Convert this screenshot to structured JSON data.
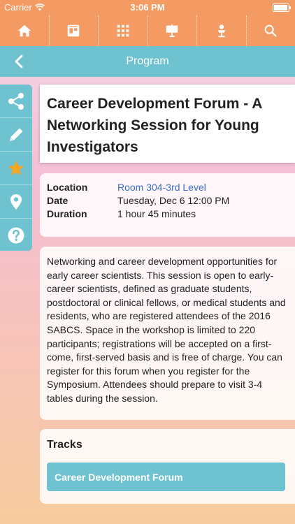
{
  "status_bar": {
    "carrier": "Carrier",
    "time": "3:06 PM"
  },
  "nav": {
    "icons": [
      "home-icon",
      "exhibitor-booth-icon",
      "floor-grid-icon",
      "presentation-board-icon",
      "speaker-podium-icon",
      "search-icon"
    ]
  },
  "header": {
    "title": "Program"
  },
  "side_toolbar": {
    "icons": [
      "share-icon",
      "pencil-icon",
      "star-icon",
      "map-pin-icon",
      "help-icon"
    ],
    "star_color": "#f5a623"
  },
  "session": {
    "title": "Career Development Forum - A Networking Session for Young Investigators",
    "location_label": "Location",
    "location_value": "Room 304-3rd Level",
    "date_label": "Date",
    "date_value": "Tuesday, Dec 6 12:00 PM",
    "duration_label": "Duration",
    "duration_value": "1 hour 45 minutes",
    "description": "Networking and career development opportunities for early career scientists. This session is open to early-career scientists, defined as graduate students, postdoctoral or clinical fellows, or medical students and residents, who are registered attendees of the 2016 SABCS. Space in the workshop is limited to 220 participants; registrations will be accepted on a first-come, first-served basis and is free of charge. You can register for this forum when you register for the Symposium. Attendees should prepare to visit 3-4 tables during the session."
  },
  "tracks": {
    "title": "Tracks",
    "items": [
      "Career Development Forum"
    ]
  },
  "colors": {
    "nav_orange": "#f49a63",
    "accent_teal": "#6fc2d0",
    "link_blue": "#3a6fc1"
  }
}
